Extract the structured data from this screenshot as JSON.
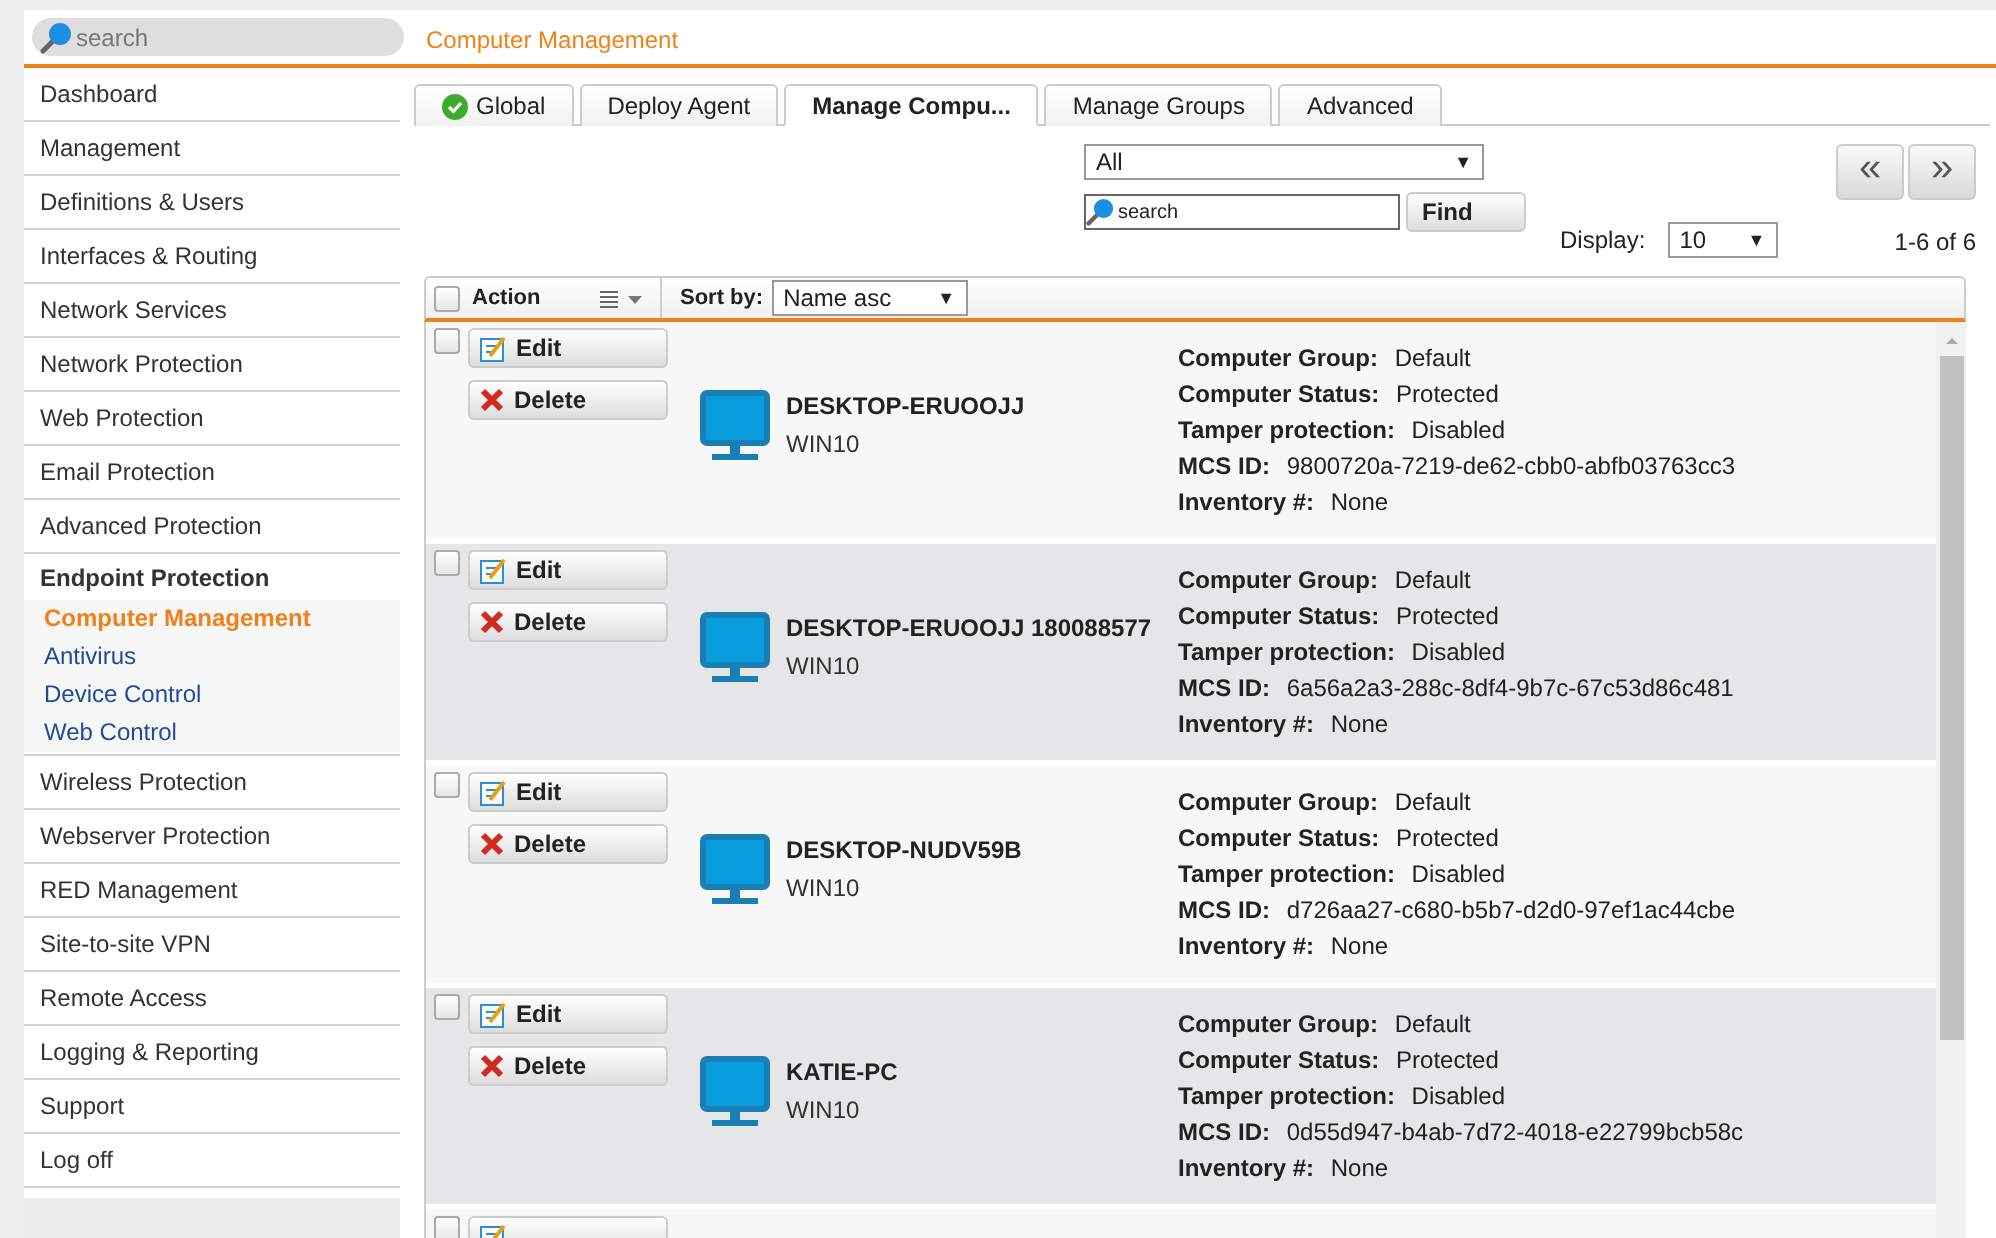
{
  "search": {
    "placeholder": "search"
  },
  "header": {
    "title": "Computer Management"
  },
  "sidebar": {
    "items": [
      {
        "label": "Dashboard",
        "expanded": false
      },
      {
        "label": "Management",
        "expanded": false
      },
      {
        "label": "Definitions & Users",
        "expanded": false
      },
      {
        "label": "Interfaces & Routing",
        "expanded": false
      },
      {
        "label": "Network Services",
        "expanded": false
      },
      {
        "label": "Network Protection",
        "expanded": false
      },
      {
        "label": "Web Protection",
        "expanded": false
      },
      {
        "label": "Email Protection",
        "expanded": false
      },
      {
        "label": "Advanced Protection",
        "expanded": false
      },
      {
        "label": "Endpoint Protection",
        "expanded": true,
        "children": [
          {
            "label": "Computer Management",
            "selected": true
          },
          {
            "label": "Antivirus",
            "selected": false
          },
          {
            "label": "Device Control",
            "selected": false
          },
          {
            "label": "Web Control",
            "selected": false
          }
        ]
      },
      {
        "label": "Wireless Protection",
        "expanded": false
      },
      {
        "label": "Webserver Protection",
        "expanded": false
      },
      {
        "label": "RED Management",
        "expanded": false
      },
      {
        "label": "Site-to-site VPN",
        "expanded": false
      },
      {
        "label": "Remote Access",
        "expanded": false
      },
      {
        "label": "Logging & Reporting",
        "expanded": false
      },
      {
        "label": "Support",
        "expanded": false
      },
      {
        "label": "Log off",
        "expanded": false
      }
    ]
  },
  "tabs": [
    {
      "label": "Global",
      "selected": false,
      "kind": "status"
    },
    {
      "label": "Deploy Agent",
      "selected": false,
      "kind": "plain"
    },
    {
      "label": "Manage Compu...",
      "selected": true,
      "kind": "plain"
    },
    {
      "label": "Manage Groups",
      "selected": false,
      "kind": "plain"
    },
    {
      "label": "Advanced",
      "selected": false,
      "kind": "plain"
    }
  ],
  "filter": {
    "group_select": "All",
    "group_caret": "▼",
    "search": {
      "placeholder": "search"
    },
    "find_button": "Find",
    "display_label": "Display:",
    "display_value": "10",
    "display_caret": "▼"
  },
  "pager": {
    "prev": "«",
    "next": "»",
    "count": "1-6 of 6"
  },
  "table": {
    "header": {
      "checked": false,
      "action": "Action",
      "sort_label": "Sort by:",
      "sort_value": "Name asc",
      "sort_caret": "▼"
    },
    "rows": [
      {
        "checked": false,
        "edit": "Edit",
        "delete": "Delete",
        "name": "DESKTOP-ERUOOJJ",
        "os": "WIN10",
        "fields": [
          {
            "label": "Computer Group:",
            "value": "Default"
          },
          {
            "label": "Computer Status:",
            "value": "Protected"
          },
          {
            "label": "Tamper protection:",
            "value": "Disabled"
          },
          {
            "label": "MCS ID:",
            "value": "9800720a-7219-de62-cbb0-abfb03763cc3"
          },
          {
            "label": "Inventory #:",
            "value": "None"
          }
        ]
      },
      {
        "checked": false,
        "edit": "Edit",
        "delete": "Delete",
        "name": "DESKTOP-ERUOOJJ 180088577",
        "os": "WIN10",
        "fields": [
          {
            "label": "Computer Group:",
            "value": "Default"
          },
          {
            "label": "Computer Status:",
            "value": "Protected"
          },
          {
            "label": "Tamper protection:",
            "value": "Disabled"
          },
          {
            "label": "MCS ID:",
            "value": "6a56a2a3-288c-8df4-9b7c-67c53d86c481"
          },
          {
            "label": "Inventory #:",
            "value": "None"
          }
        ]
      },
      {
        "checked": false,
        "edit": "Edit",
        "delete": "Delete",
        "name": "DESKTOP-NUDV59B",
        "os": "WIN10",
        "fields": [
          {
            "label": "Computer Group:",
            "value": "Default"
          },
          {
            "label": "Computer Status:",
            "value": "Protected"
          },
          {
            "label": "Tamper protection:",
            "value": "Disabled"
          },
          {
            "label": "MCS ID:",
            "value": "d726aa27-c680-b5b7-d2d0-97ef1ac44cbe"
          },
          {
            "label": "Inventory #:",
            "value": "None"
          }
        ]
      },
      {
        "checked": false,
        "edit": "Edit",
        "delete": "Delete",
        "name": "KATIE-PC",
        "os": "WIN10",
        "fields": [
          {
            "label": "Computer Group:",
            "value": "Default"
          },
          {
            "label": "Computer Status:",
            "value": "Protected"
          },
          {
            "label": "Tamper protection:",
            "value": "Disabled"
          },
          {
            "label": "MCS ID:",
            "value": "0d55d947-b4ab-7d72-4018-e22799bcb58c"
          },
          {
            "label": "Inventory #:",
            "value": "None"
          }
        ]
      },
      {
        "checked": false,
        "fields": []
      }
    ]
  }
}
